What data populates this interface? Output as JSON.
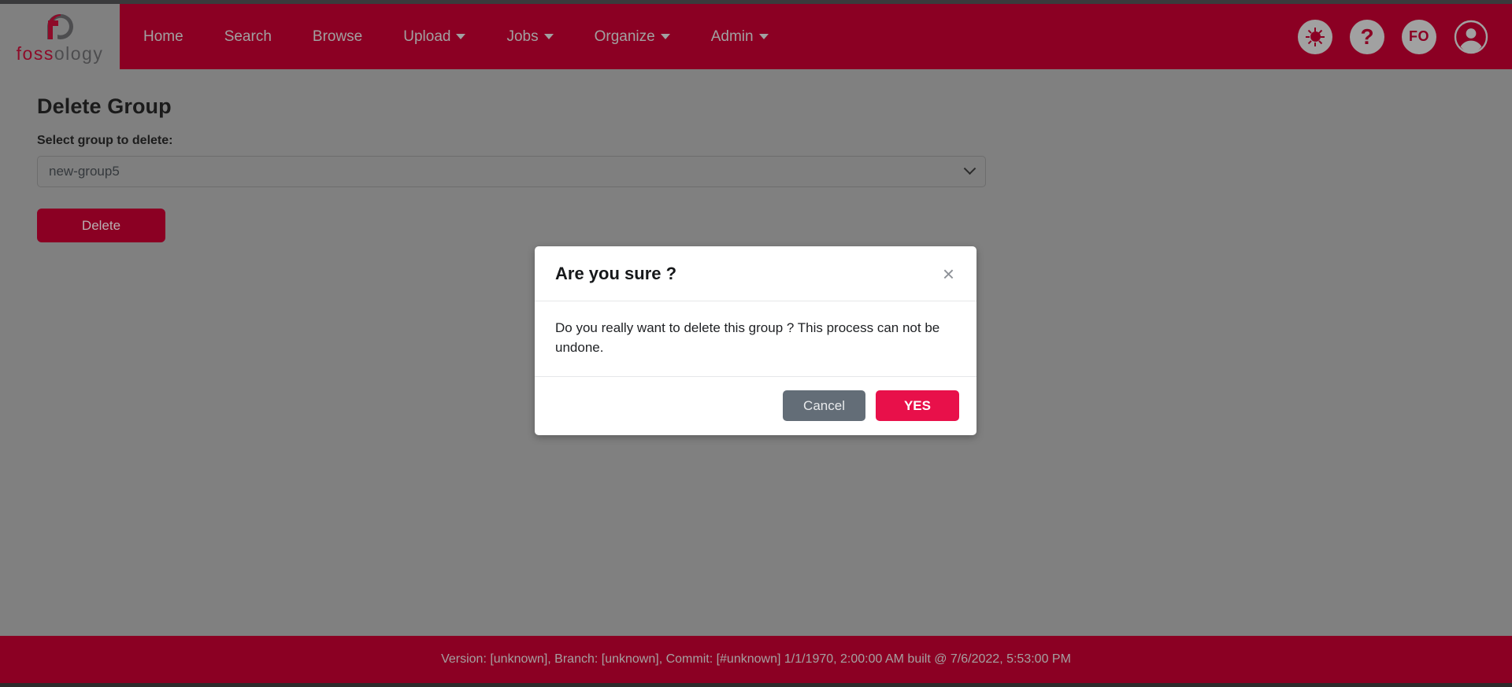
{
  "brand": {
    "word_part1": "foss",
    "word_part2": "ology",
    "logo_icon": "fossology-logo-icon"
  },
  "nav": {
    "items": [
      {
        "label": "Home",
        "has_caret": false,
        "name": "nav-item-home"
      },
      {
        "label": "Search",
        "has_caret": false,
        "name": "nav-item-search"
      },
      {
        "label": "Browse",
        "has_caret": false,
        "name": "nav-item-browse"
      },
      {
        "label": "Upload",
        "has_caret": true,
        "name": "nav-item-upload"
      },
      {
        "label": "Jobs",
        "has_caret": true,
        "name": "nav-item-jobs"
      },
      {
        "label": "Organize",
        "has_caret": true,
        "name": "nav-item-organize"
      },
      {
        "label": "Admin",
        "has_caret": true,
        "name": "nav-item-admin"
      }
    ],
    "right_icons": [
      {
        "name": "brightness-icon",
        "label": ""
      },
      {
        "name": "help-icon",
        "label": "?"
      },
      {
        "name": "user-initials-avatar",
        "label": "FO"
      },
      {
        "name": "user-account-icon",
        "label": ""
      }
    ]
  },
  "main": {
    "title": "Delete Group",
    "select_label": "Select group to delete:",
    "selected_group": "new-group5",
    "delete_button": "Delete"
  },
  "modal": {
    "title": "Are you sure ?",
    "close_label": "×",
    "body": "Do you really want to delete this group ? This process can not be undone.",
    "cancel_label": "Cancel",
    "confirm_label": "YES"
  },
  "footer": {
    "text": "Version: [unknown], Branch: [unknown], Commit: [#unknown] 1/1/1970, 2:00:00 AM built @ 7/6/2022, 5:53:00 PM"
  },
  "colors": {
    "brand_red": "#8b0023",
    "page_bg": "#808080",
    "confirm_red": "#e8104a",
    "cancel_gray": "#636d77"
  }
}
